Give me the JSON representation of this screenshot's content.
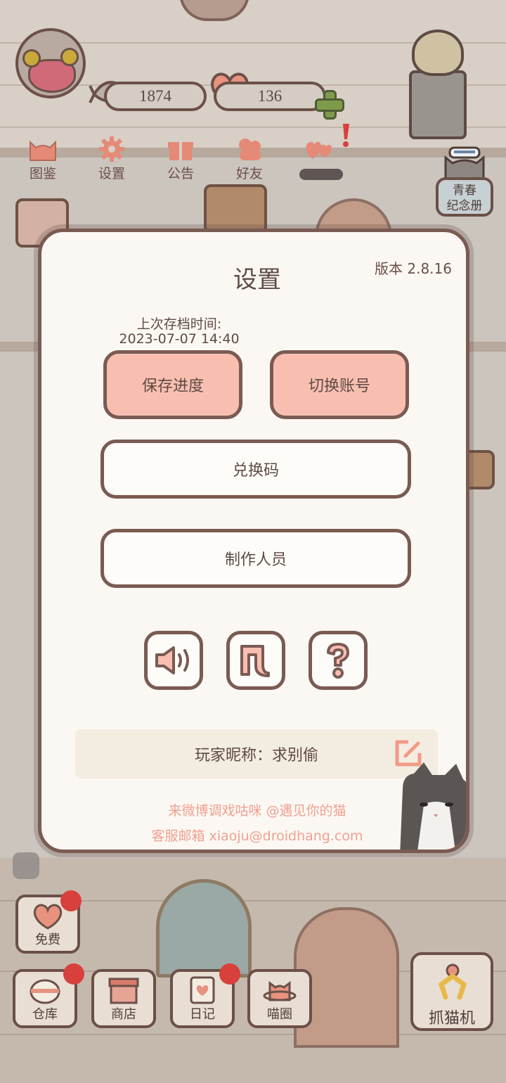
{
  "hud": {
    "fish_count": "1874",
    "heart_count": "136"
  },
  "top_tabs": [
    {
      "label": "图鉴",
      "icon": "cat-face-icon"
    },
    {
      "label": "设置",
      "icon": "gear-icon"
    },
    {
      "label": "公告",
      "icon": "gift-icon"
    },
    {
      "label": "好友",
      "icon": "friends-icon"
    },
    {
      "label": "",
      "icon": "hearts-icon"
    }
  ],
  "memorial": {
    "label_line1": "青春",
    "label_line2": "纪念册"
  },
  "settings": {
    "title": "设置",
    "version": "版本 2.8.16",
    "last_save_label": "上次存档时间:",
    "last_save_time": "2023-07-07 14:40",
    "save_button": "保存进度",
    "switch_account_button": "切换账号",
    "redeem_button": "兑换码",
    "credits_button": "制作人员",
    "icon_buttons": [
      "sound-icon",
      "music-icon",
      "help-icon"
    ],
    "nickname_label": "玩家昵称：求别偷",
    "weibo_line": "来微博调戏咕咪 @遇见你的猫",
    "support_line": "客服邮箱 xiaoju@droidhang.com"
  },
  "bottom_nav": {
    "free": "免费",
    "warehouse": "仓库",
    "shop": "商店",
    "diary": "日记",
    "cat_circle": "喵圈",
    "claw_machine": "抓猫机"
  },
  "colors": {
    "accent_pink": "#f8bfb1",
    "border_brown": "#7a5b53",
    "footer_text": "#f0a090",
    "red_dot": "#d8403c"
  }
}
